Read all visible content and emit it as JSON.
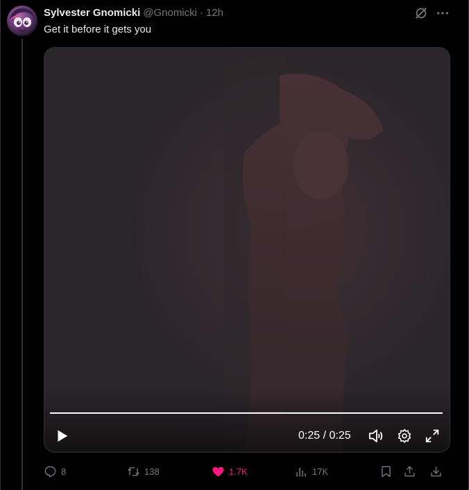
{
  "tweet": {
    "display_name": "Sylvester Gnomicki",
    "handle": "@Gnomicki",
    "separator": "·",
    "time_ago": "12h",
    "text": "Get it before it gets you"
  },
  "video": {
    "current_time": "0:25",
    "duration": "0:25",
    "time_display": "0:25 / 0:25",
    "progress_percent": 100,
    "state": "paused"
  },
  "actions": {
    "replies": "8",
    "reposts": "138",
    "likes": "1.7K",
    "views": "17K"
  },
  "colors": {
    "background": "#000000",
    "text_primary": "#e7e9ea",
    "text_secondary": "#71767b",
    "like_active": "#f91880",
    "border": "#2f3336"
  },
  "icons": {
    "reply": "speech-bubble-icon",
    "repost": "repost-arrows-icon",
    "like": "heart-icon",
    "views": "bar-chart-icon",
    "bookmark": "bookmark-icon",
    "share": "share-upload-icon",
    "download": "download-icon",
    "grok": "grok-slash-circle-icon",
    "more": "more-dots-icon",
    "play": "play-icon",
    "volume": "volume-icon",
    "settings": "gear-icon",
    "fullscreen": "fullscreen-icon"
  }
}
